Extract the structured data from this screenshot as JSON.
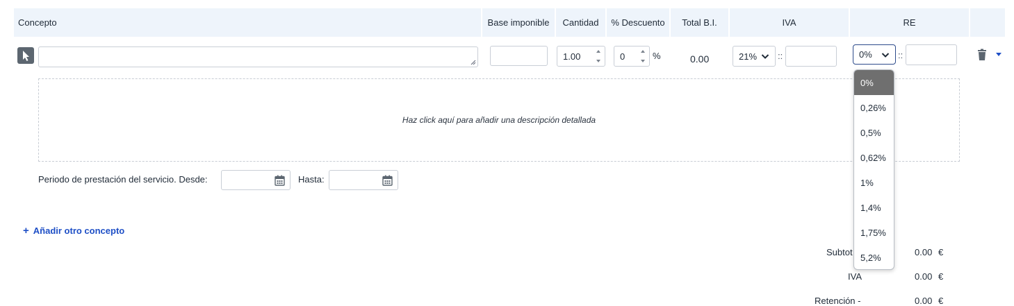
{
  "header": {
    "concepto": "Concepto",
    "base_imponible": "Base imponible",
    "cantidad": "Cantidad",
    "descuento": "% Descuento",
    "total_bi": "Total B.I.",
    "iva": "IVA",
    "re": "RE"
  },
  "line": {
    "concept_value": "",
    "base_value": "",
    "quantity": "1.00",
    "discount": "0",
    "discount_unit": "%",
    "total_bi": "0.00",
    "iva_selected": "21%",
    "iva_sep": "::",
    "iva_amount": "",
    "re_selected": "0%",
    "re_sep": "::",
    "re_amount": ""
  },
  "re_options": [
    "0%",
    "0,26%",
    "0,5%",
    "0,62%",
    "1%",
    "1,4%",
    "1,75%",
    "5,2%"
  ],
  "re_selected_index": 0,
  "description_hint": "Haz click aquí para añadir una descripción detallada",
  "period": {
    "label_desde": "Periodo de prestación del servicio. Desde:",
    "label_hasta": "Hasta:",
    "desde_value": "",
    "hasta_value": ""
  },
  "add_concept": "Añadir otro concepto",
  "totals": {
    "subtotal_label": "Subtot",
    "subtotal_value": "0.00",
    "iva_label": "IVA",
    "iva_value": "0.00",
    "retencion_label": "Retención -",
    "retencion_value": "0.00",
    "currency": "€"
  },
  "colors": {
    "header_bg": "#eef4fb",
    "accent_blue": "#1e4fc6",
    "selected_option": "#6f6f6f",
    "active_border": "#2c4a8a"
  }
}
